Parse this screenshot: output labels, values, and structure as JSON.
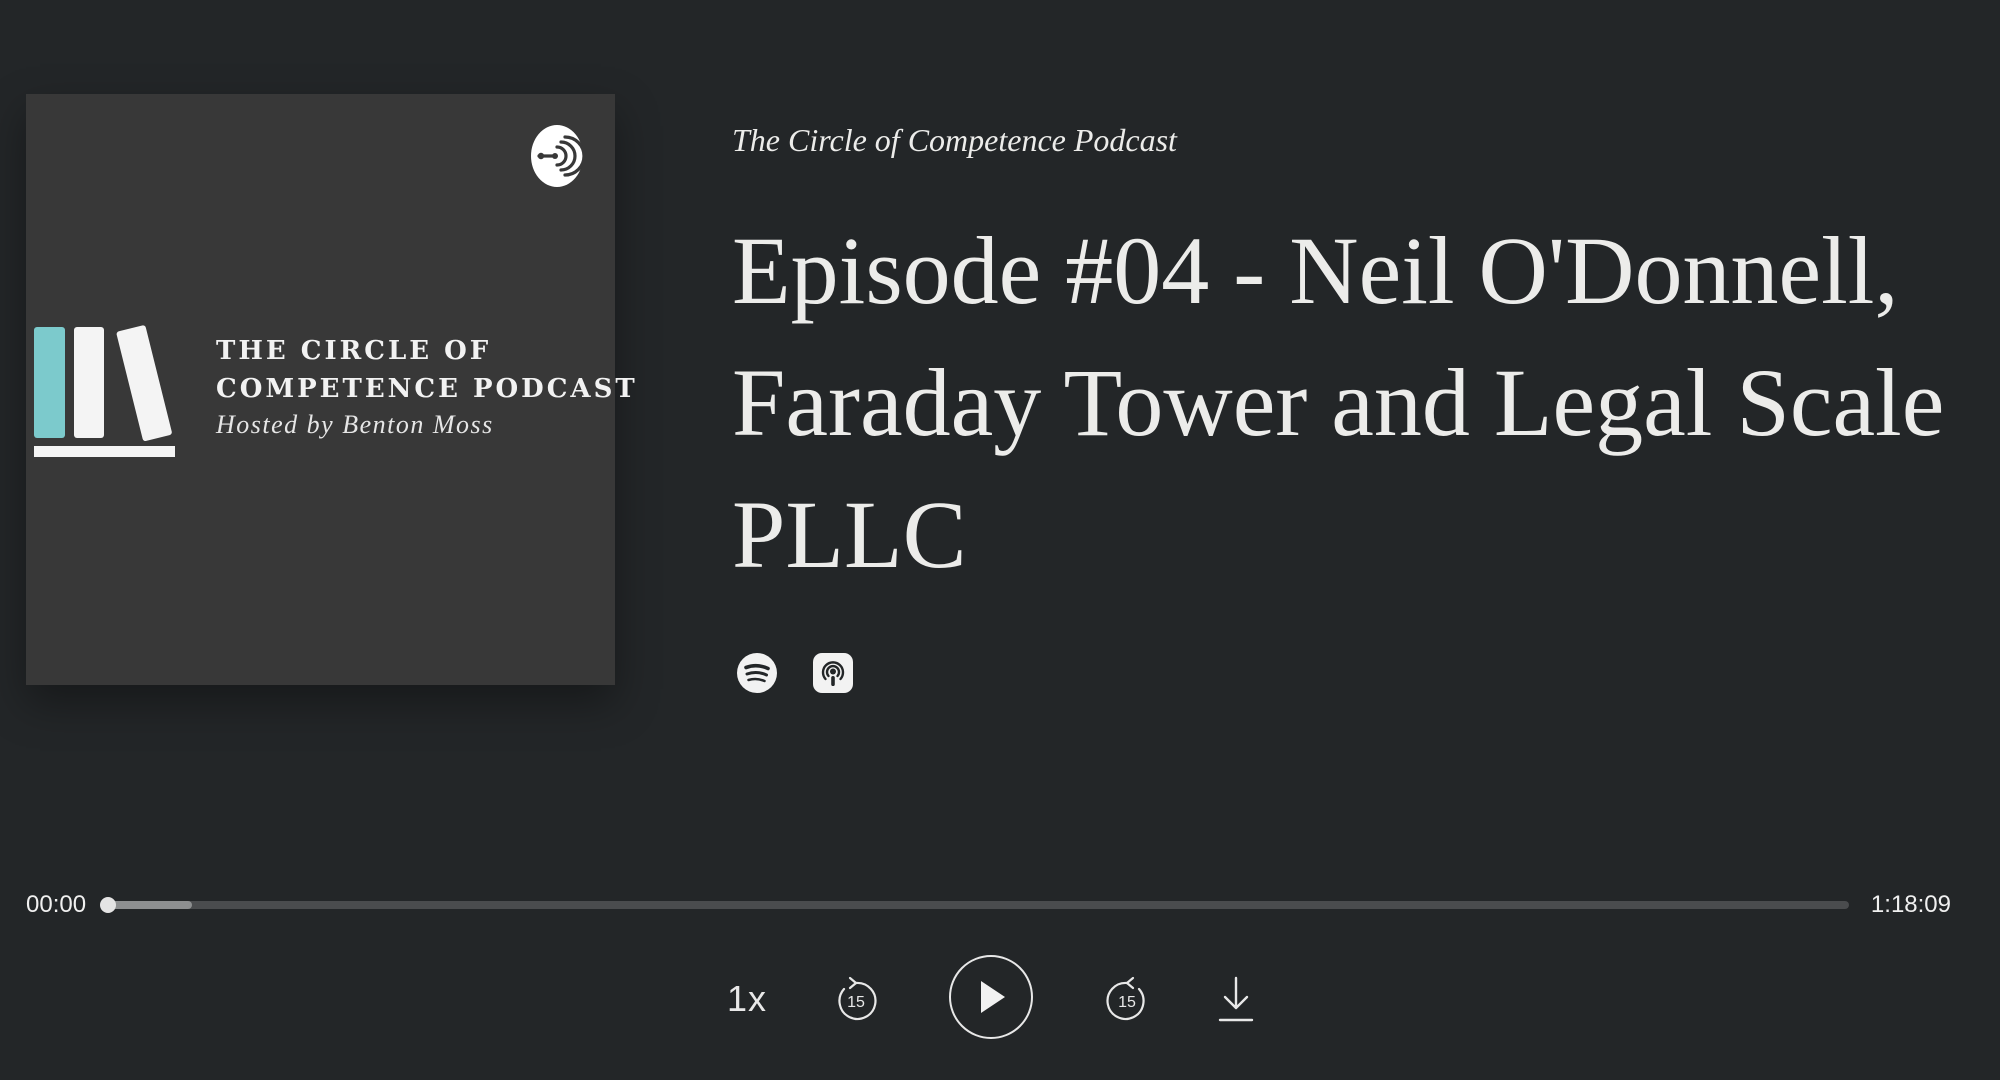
{
  "cover": {
    "title_line1": "THE CIRCLE OF",
    "title_line2": "COMPETENCE PODCAST",
    "host_line": "Hosted by Benton Moss",
    "accent_color": "#7ccacc",
    "badge_icon": "anchor-podcast-icon"
  },
  "episode": {
    "show_name": "The Circle of Competence Podcast",
    "title": "Episode #04 - Neil O'Donnell, Faraday Tower and Legal Scale PLLC"
  },
  "platforms": [
    {
      "name": "spotify-icon"
    },
    {
      "name": "apple-podcasts-icon"
    }
  ],
  "player": {
    "current_time": "00:00",
    "duration": "1:18:09",
    "progress_fraction": 0.0,
    "buffered_fraction": 0.048,
    "speed_label": "1x",
    "skip_back_label": "15",
    "skip_forward_label": "15",
    "play_icon": "play-icon",
    "download_icon": "download-icon"
  }
}
